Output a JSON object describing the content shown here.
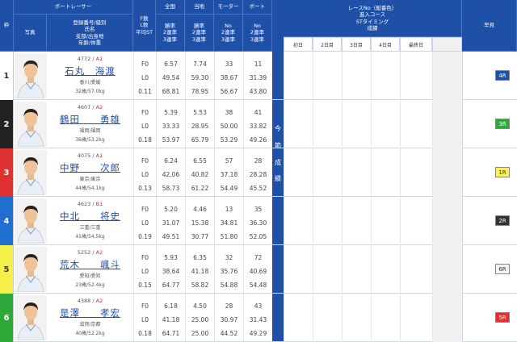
{
  "header": {
    "waku": "枠",
    "photo": "写真",
    "racer": "ボートレーサー",
    "racer_sub": "登録番号/級別\n氏名\n支部/出身地\n年齢/体重",
    "stats_label": "F数\nL数\n平均ST",
    "zenkoku": "全国",
    "tochi": "当地",
    "motor": "モーター",
    "boat": "ボート",
    "rate_label": "勝率\n2連率\n3連率",
    "no_label": "No\n2連率\n3連率",
    "results": "レースNo（艇番色）\n進入コース\nSTタイミング\n成績",
    "junmi": "早見",
    "days": [
      "初日",
      "2日目",
      "3日目",
      "4日目",
      "最終日"
    ],
    "konsetsu": "今\n節\n成\n績"
  },
  "racers": [
    {
      "waku": "1",
      "color": "#ffffff",
      "textcolor": "#333",
      "reg": "4772 / ",
      "cls": "A1",
      "name": "石丸　海渡",
      "place": "香川/愛媛",
      "age": "32歳/57.0kg",
      "f": "F0",
      "l": "L0",
      "st": "0.11",
      "z1": "6.57",
      "z2": "49.54",
      "z3": "68.81",
      "t1": "7.74",
      "t2": "59.30",
      "t3": "78.95",
      "m1": "33",
      "m2": "38.67",
      "m3": "56.67",
      "b1": "11",
      "b2": "31.39",
      "b3": "43.80",
      "jun": "4R",
      "junbg": "#1f50a8",
      "junfg": "#fff"
    },
    {
      "waku": "2",
      "color": "#222222",
      "textcolor": "#fff",
      "reg": "4607 / ",
      "cls": "A2",
      "name": "鶴田　　勇雄",
      "place": "福岡/福岡",
      "age": "36歳/53.2kg",
      "f": "F0",
      "l": "L0",
      "st": "0.18",
      "z1": "5.39",
      "z2": "33.33",
      "z3": "53.97",
      "t1": "5.53",
      "t2": "28.95",
      "t3": "65.79",
      "m1": "38",
      "m2": "50.00",
      "m3": "53.29",
      "b1": "41",
      "b2": "33.82",
      "b3": "49.26",
      "jun": "3R",
      "junbg": "#2fa83a",
      "junfg": "#fff"
    },
    {
      "waku": "3",
      "color": "#e03131",
      "textcolor": "#fff",
      "reg": "4075 / ",
      "cls": "A1",
      "name": "中野　　次郎",
      "place": "東京/東京",
      "age": "44歳/54.1kg",
      "f": "F0",
      "l": "L0",
      "st": "0.13",
      "z1": "6.24",
      "z2": "42.06",
      "z3": "58.73",
      "t1": "6.55",
      "t2": "40.82",
      "t3": "61.22",
      "m1": "57",
      "m2": "37.18",
      "m3": "54.49",
      "b1": "28",
      "b2": "28.28",
      "b3": "45.52",
      "jun": "1R",
      "junbg": "#f7f06a",
      "junfg": "#333"
    },
    {
      "waku": "4",
      "color": "#1f6fd0",
      "textcolor": "#fff",
      "reg": "4623 / ",
      "cls": "B1",
      "name": "中北　　将史",
      "place": "三重/三重",
      "age": "41歳/54.5kg",
      "f": "F0",
      "l": "L0",
      "st": "0.19",
      "z1": "5.20",
      "z2": "31.07",
      "z3": "49.51",
      "t1": "4.46",
      "t2": "15.38",
      "t3": "30.77",
      "m1": "13",
      "m2": "34.81",
      "m3": "51.80",
      "b1": "35",
      "b2": "36.30",
      "b3": "52.05",
      "jun": "2R",
      "junbg": "#333333",
      "junfg": "#fff"
    },
    {
      "waku": "5",
      "color": "#f5ef4a",
      "textcolor": "#333",
      "reg": "5252 / ",
      "cls": "A2",
      "name": "荒木　　颯斗",
      "place": "愛知/愛知",
      "age": "23歳/52.4kg",
      "f": "F0",
      "l": "L0",
      "st": "0.15",
      "z1": "5.93",
      "z2": "38.64",
      "z3": "64.77",
      "t1": "6.35",
      "t2": "41.18",
      "t3": "58.82",
      "m1": "32",
      "m2": "35.76",
      "m3": "54.88",
      "b1": "72",
      "b2": "40.69",
      "b3": "54.48",
      "jun": "6R",
      "junbg": "#f2f2f2",
      "junfg": "#333"
    },
    {
      "waku": "6",
      "color": "#2fa83a",
      "textcolor": "#fff",
      "reg": "4388 / ",
      "cls": "A2",
      "name": "是澤　　孝宏",
      "place": "滋賀/京都",
      "age": "40歳/52.2kg",
      "f": "F0",
      "l": "L0",
      "st": "0.18",
      "z1": "6.18",
      "z2": "41.18",
      "z3": "64.71",
      "t1": "4.50",
      "t2": "25.00",
      "t3": "25.00",
      "m1": "28",
      "m2": "30.97",
      "m3": "44.52",
      "b1": "43",
      "b2": "31.43",
      "b3": "49.29",
      "jun": "5R",
      "junbg": "#e03131",
      "junfg": "#fff"
    }
  ]
}
